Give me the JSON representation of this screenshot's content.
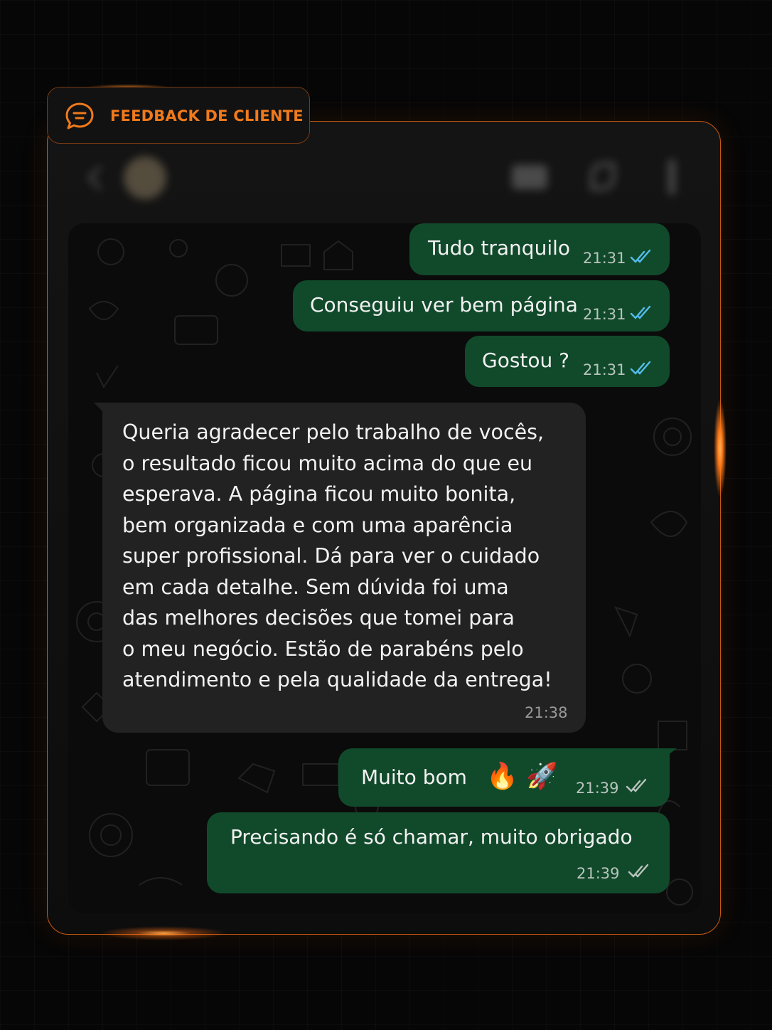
{
  "badge": {
    "label": "FEEDBACK DE CLIENTE",
    "icon": "chat-bubble-icon",
    "color": "#f07a1c"
  },
  "header": {
    "icons": [
      "back-arrow-icon",
      "video-icon",
      "phone-icon",
      "menu-icon"
    ]
  },
  "messages": [
    {
      "direction": "outgoing",
      "text": "Tudo tranquilo",
      "time": "21:31",
      "status": "read"
    },
    {
      "direction": "outgoing",
      "text": "Conseguiu ver bem página",
      "time": "21:31",
      "status": "read"
    },
    {
      "direction": "outgoing",
      "text": "Gostou ?",
      "time": "21:31",
      "status": "read"
    },
    {
      "direction": "incoming",
      "text": "Queria agradecer pelo trabalho de vocês,\no resultado ficou muito acima do que eu\nesperava. A página ficou muito bonita,\nbem organizada e com uma aparência\nsuper profissional. Dá para ver o cuidado\nem cada detalhe. Sem dúvida foi uma\ndas melhores decisões que tomei para\no meu negócio. Estão de parabéns pelo\natendimento e pela qualidade da entrega!",
      "time": "21:38"
    },
    {
      "direction": "outgoing",
      "text": "Muito bom",
      "emoji": "🔥 🚀",
      "time": "21:39",
      "status": "delivered"
    },
    {
      "direction": "outgoing",
      "text": "Precisando é só chamar, muito obrigado",
      "time": "21:39",
      "status": "delivered"
    }
  ],
  "colors": {
    "outgoing_bubble": "#114a2b",
    "incoming_bubble": "#222222",
    "read_ticks": "#53bdeb",
    "accent": "#f07a1c"
  }
}
